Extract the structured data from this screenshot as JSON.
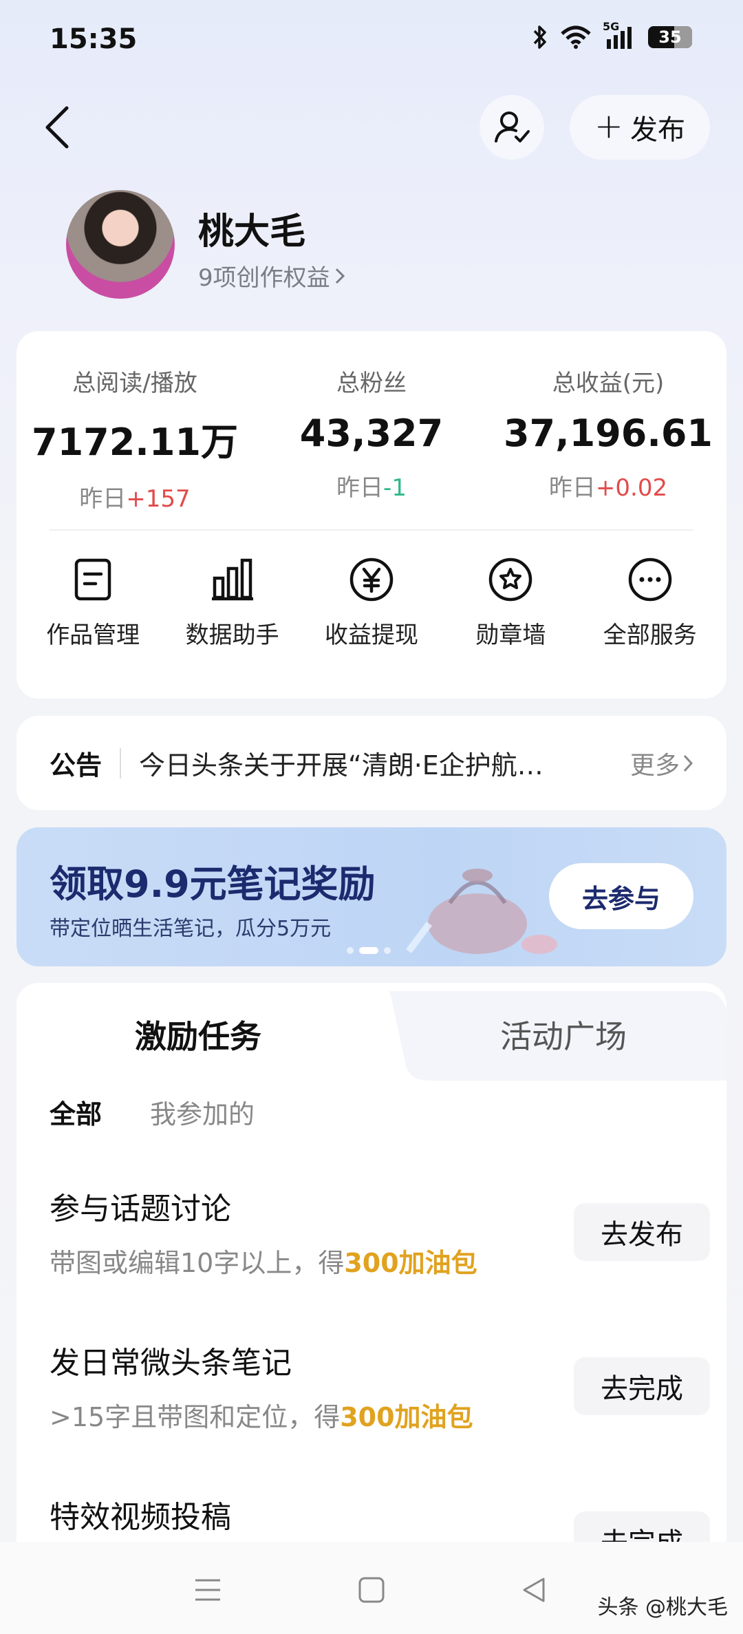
{
  "status_bar": {
    "time": "15:35",
    "network": "5G",
    "battery": "35"
  },
  "header": {
    "publish_label": "发布"
  },
  "profile": {
    "name": "桃大毛",
    "rights": "9项创作权益"
  },
  "stats": [
    {
      "label": "总阅读/播放",
      "value": "7172.11万",
      "delta_prefix": "昨日",
      "delta": "+157",
      "trend": "up"
    },
    {
      "label": "总粉丝",
      "value": "43,327",
      "delta_prefix": "昨日",
      "delta": "-1",
      "trend": "down"
    },
    {
      "label": "总收益(元)",
      "value": "37,196.61",
      "delta_prefix": "昨日",
      "delta": "+0.02",
      "trend": "up"
    }
  ],
  "services": [
    {
      "label": "作品管理",
      "icon": "document-icon"
    },
    {
      "label": "数据助手",
      "icon": "bar-chart-icon"
    },
    {
      "label": "收益提现",
      "icon": "yuan-icon"
    },
    {
      "label": "勋章墙",
      "icon": "badge-icon"
    },
    {
      "label": "全部服务",
      "icon": "more-icon"
    }
  ],
  "notice": {
    "title": "公告",
    "text": "今日头条关于开展“清朗·E企护航…",
    "more": "更多"
  },
  "banner": {
    "title": "领取9.9元笔记奖励",
    "subtitle": "带定位晒生活笔记，瓜分5万元",
    "button": "去参与"
  },
  "tabs": [
    {
      "label": "激励任务",
      "active": true
    },
    {
      "label": "活动广场",
      "active": false
    }
  ],
  "filters": [
    {
      "label": "全部",
      "active": true
    },
    {
      "label": "我参加的",
      "active": false
    }
  ],
  "tasks": [
    {
      "title": "参与话题讨论",
      "desc": "带图或编辑10字以上，得",
      "reward": "300加油包",
      "button": "去发布"
    },
    {
      "title": "发日常微头条笔记",
      "desc": ">15字且带图和定位，得",
      "reward": "300加油包",
      "button": "去完成"
    },
    {
      "title": "特效视频投稿",
      "desc": "",
      "reward": "",
      "button": "去完成"
    }
  ],
  "watermark": "头条 @桃大毛",
  "colors": {
    "accent_up": "#e24a4a",
    "accent_down": "#2eb88a",
    "reward": "#e0a21f",
    "banner_title": "#1c2a6e"
  }
}
